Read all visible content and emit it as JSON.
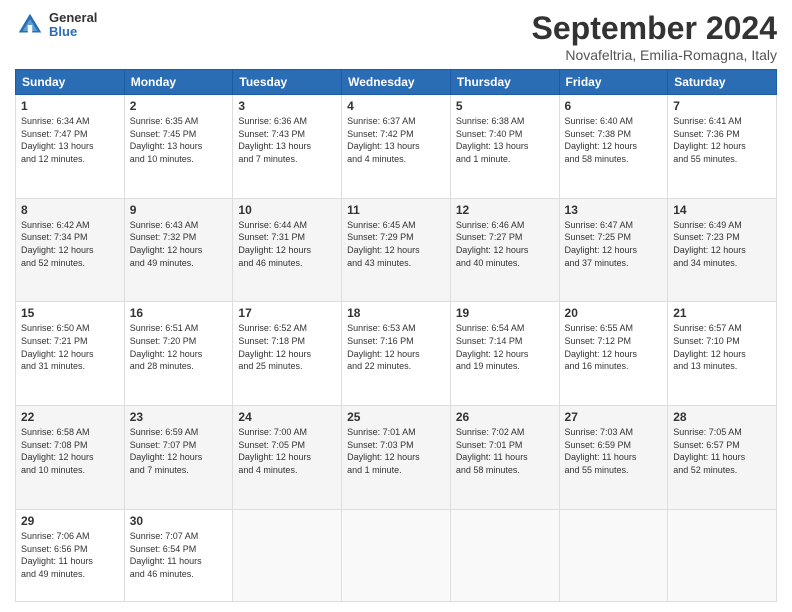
{
  "logo": {
    "general": "General",
    "blue": "Blue"
  },
  "title": "September 2024",
  "location": "Novafeltria, Emilia-Romagna, Italy",
  "weekdays": [
    "Sunday",
    "Monday",
    "Tuesday",
    "Wednesday",
    "Thursday",
    "Friday",
    "Saturday"
  ],
  "weeks": [
    [
      {
        "day": "1",
        "info": "Sunrise: 6:34 AM\nSunset: 7:47 PM\nDaylight: 13 hours\nand 12 minutes."
      },
      {
        "day": "2",
        "info": "Sunrise: 6:35 AM\nSunset: 7:45 PM\nDaylight: 13 hours\nand 10 minutes."
      },
      {
        "day": "3",
        "info": "Sunrise: 6:36 AM\nSunset: 7:43 PM\nDaylight: 13 hours\nand 7 minutes."
      },
      {
        "day": "4",
        "info": "Sunrise: 6:37 AM\nSunset: 7:42 PM\nDaylight: 13 hours\nand 4 minutes."
      },
      {
        "day": "5",
        "info": "Sunrise: 6:38 AM\nSunset: 7:40 PM\nDaylight: 13 hours\nand 1 minute."
      },
      {
        "day": "6",
        "info": "Sunrise: 6:40 AM\nSunset: 7:38 PM\nDaylight: 12 hours\nand 58 minutes."
      },
      {
        "day": "7",
        "info": "Sunrise: 6:41 AM\nSunset: 7:36 PM\nDaylight: 12 hours\nand 55 minutes."
      }
    ],
    [
      {
        "day": "8",
        "info": "Sunrise: 6:42 AM\nSunset: 7:34 PM\nDaylight: 12 hours\nand 52 minutes."
      },
      {
        "day": "9",
        "info": "Sunrise: 6:43 AM\nSunset: 7:32 PM\nDaylight: 12 hours\nand 49 minutes."
      },
      {
        "day": "10",
        "info": "Sunrise: 6:44 AM\nSunset: 7:31 PM\nDaylight: 12 hours\nand 46 minutes."
      },
      {
        "day": "11",
        "info": "Sunrise: 6:45 AM\nSunset: 7:29 PM\nDaylight: 12 hours\nand 43 minutes."
      },
      {
        "day": "12",
        "info": "Sunrise: 6:46 AM\nSunset: 7:27 PM\nDaylight: 12 hours\nand 40 minutes."
      },
      {
        "day": "13",
        "info": "Sunrise: 6:47 AM\nSunset: 7:25 PM\nDaylight: 12 hours\nand 37 minutes."
      },
      {
        "day": "14",
        "info": "Sunrise: 6:49 AM\nSunset: 7:23 PM\nDaylight: 12 hours\nand 34 minutes."
      }
    ],
    [
      {
        "day": "15",
        "info": "Sunrise: 6:50 AM\nSunset: 7:21 PM\nDaylight: 12 hours\nand 31 minutes."
      },
      {
        "day": "16",
        "info": "Sunrise: 6:51 AM\nSunset: 7:20 PM\nDaylight: 12 hours\nand 28 minutes."
      },
      {
        "day": "17",
        "info": "Sunrise: 6:52 AM\nSunset: 7:18 PM\nDaylight: 12 hours\nand 25 minutes."
      },
      {
        "day": "18",
        "info": "Sunrise: 6:53 AM\nSunset: 7:16 PM\nDaylight: 12 hours\nand 22 minutes."
      },
      {
        "day": "19",
        "info": "Sunrise: 6:54 AM\nSunset: 7:14 PM\nDaylight: 12 hours\nand 19 minutes."
      },
      {
        "day": "20",
        "info": "Sunrise: 6:55 AM\nSunset: 7:12 PM\nDaylight: 12 hours\nand 16 minutes."
      },
      {
        "day": "21",
        "info": "Sunrise: 6:57 AM\nSunset: 7:10 PM\nDaylight: 12 hours\nand 13 minutes."
      }
    ],
    [
      {
        "day": "22",
        "info": "Sunrise: 6:58 AM\nSunset: 7:08 PM\nDaylight: 12 hours\nand 10 minutes."
      },
      {
        "day": "23",
        "info": "Sunrise: 6:59 AM\nSunset: 7:07 PM\nDaylight: 12 hours\nand 7 minutes."
      },
      {
        "day": "24",
        "info": "Sunrise: 7:00 AM\nSunset: 7:05 PM\nDaylight: 12 hours\nand 4 minutes."
      },
      {
        "day": "25",
        "info": "Sunrise: 7:01 AM\nSunset: 7:03 PM\nDaylight: 12 hours\nand 1 minute."
      },
      {
        "day": "26",
        "info": "Sunrise: 7:02 AM\nSunset: 7:01 PM\nDaylight: 11 hours\nand 58 minutes."
      },
      {
        "day": "27",
        "info": "Sunrise: 7:03 AM\nSunset: 6:59 PM\nDaylight: 11 hours\nand 55 minutes."
      },
      {
        "day": "28",
        "info": "Sunrise: 7:05 AM\nSunset: 6:57 PM\nDaylight: 11 hours\nand 52 minutes."
      }
    ],
    [
      {
        "day": "29",
        "info": "Sunrise: 7:06 AM\nSunset: 6:56 PM\nDaylight: 11 hours\nand 49 minutes."
      },
      {
        "day": "30",
        "info": "Sunrise: 7:07 AM\nSunset: 6:54 PM\nDaylight: 11 hours\nand 46 minutes."
      },
      {
        "day": "",
        "info": ""
      },
      {
        "day": "",
        "info": ""
      },
      {
        "day": "",
        "info": ""
      },
      {
        "day": "",
        "info": ""
      },
      {
        "day": "",
        "info": ""
      }
    ]
  ]
}
